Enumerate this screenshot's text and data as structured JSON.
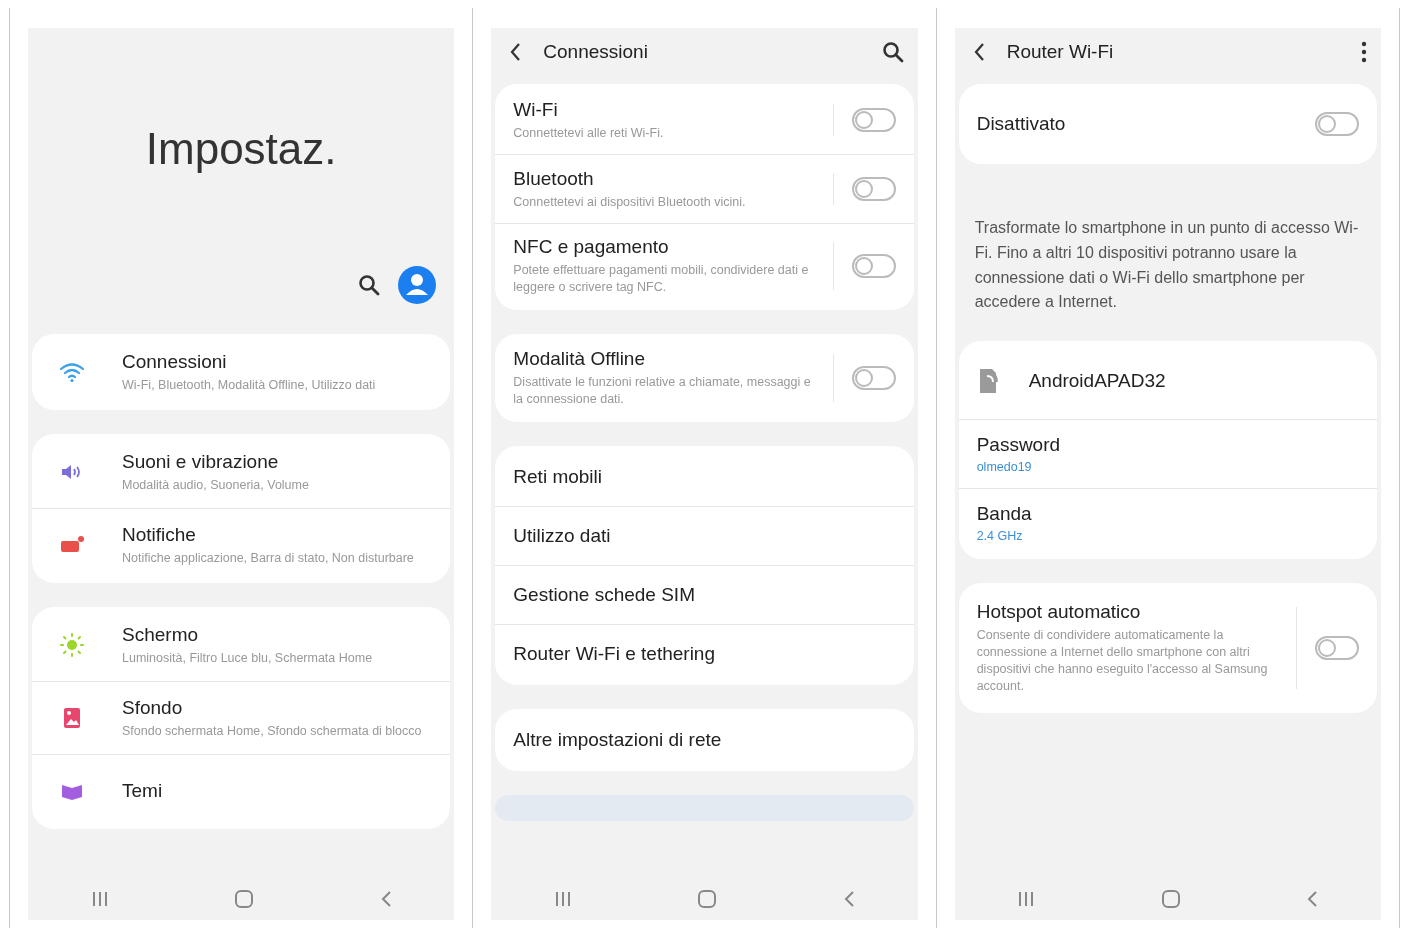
{
  "settings_home": {
    "title": "Impostaz.",
    "groups": [
      {
        "items": [
          {
            "kind": "wifi",
            "title": "Connessioni",
            "subtitle": "Wi-Fi, Bluetooth, Modalità Offline, Utilizzo dati"
          }
        ]
      },
      {
        "items": [
          {
            "kind": "sound",
            "title": "Suoni e vibrazione",
            "subtitle": "Modalità audio, Suoneria, Volume"
          },
          {
            "kind": "notifications",
            "title": "Notifiche",
            "subtitle": "Notifiche applicazione, Barra di stato, Non disturbare"
          }
        ]
      },
      {
        "items": [
          {
            "kind": "display",
            "title": "Schermo",
            "subtitle": "Luminosità, Filtro Luce blu, Schermata Home"
          },
          {
            "kind": "wallpaper",
            "title": "Sfondo",
            "subtitle": "Sfondo schermata Home, Sfondo schermata di blocco"
          },
          {
            "kind": "themes",
            "title": "Temi"
          }
        ]
      }
    ]
  },
  "connections": {
    "title": "Connessioni",
    "groups": [
      {
        "items": [
          {
            "title": "Wi-Fi",
            "subtitle": "Connettetevi alle reti Wi-Fi.",
            "on": false
          },
          {
            "title": "Bluetooth",
            "subtitle": "Connettetevi ai dispositivi Bluetooth vicini.",
            "on": false
          },
          {
            "title": "NFC e pagamento",
            "subtitle": "Potete effettuare pagamenti mobili, condividere dati e leggere o scrivere tag NFC.",
            "on": false
          }
        ]
      },
      {
        "items": [
          {
            "title": "Modalità Offline",
            "subtitle": "Disattivate le funzioni relative a chiamate, messaggi e la connessione dati.",
            "on": false
          }
        ]
      },
      {
        "items": [
          {
            "title": "Reti mobili"
          },
          {
            "title": "Utilizzo dati"
          },
          {
            "title": "Gestione schede SIM"
          },
          {
            "title": "Router Wi-Fi e tethering"
          }
        ]
      },
      {
        "items": [
          {
            "title": "Altre impostazioni di rete"
          }
        ]
      }
    ]
  },
  "hotspot": {
    "title": "Router Wi-Fi",
    "master": {
      "title": "Disattivato",
      "on": false
    },
    "description": "Trasformate lo smartphone in un punto di accesso Wi-Fi. Fino a altri 10 dispositivi potranno usare la connessione dati o Wi-Fi dello smartphone per accedere a Internet.",
    "network": {
      "name": "AndroidAPAD32"
    },
    "fields": [
      {
        "label": "Password",
        "value": "olmedo19"
      },
      {
        "label": "Banda",
        "value": "2.4 GHz"
      }
    ],
    "auto": {
      "title": "Hotspot automatico",
      "subtitle": "Consente di condividere automaticamente la connessione a Internet dello smartphone con altri dispositivi che hanno eseguito l'accesso al Samsung account.",
      "on": false
    }
  }
}
